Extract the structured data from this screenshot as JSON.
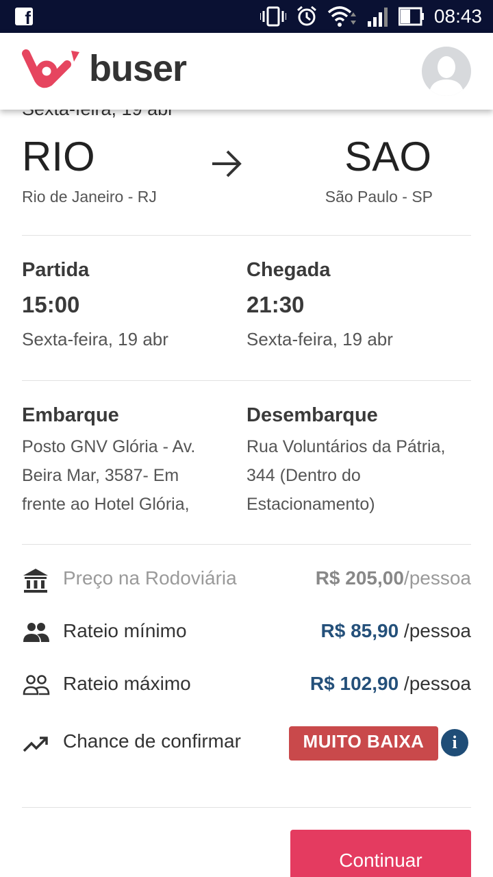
{
  "status_bar": {
    "time": "08:43",
    "icons": [
      "facebook-icon",
      "vibrate-icon",
      "alarm-icon",
      "wifi-icon",
      "signal-icon",
      "battery-icon"
    ]
  },
  "header": {
    "logo_text": "buser",
    "brand_color": "#e6455f"
  },
  "trip": {
    "date_cut": "Sexta-feira, 19 abr",
    "origin": {
      "code": "RIO",
      "city": "Rio de Janeiro - RJ"
    },
    "destination": {
      "code": "SAO",
      "city": "São Paulo - SP"
    }
  },
  "schedule": {
    "departure": {
      "label": "Partida",
      "time": "15:00",
      "date": "Sexta-feira, 19 abr"
    },
    "arrival": {
      "label": "Chegada",
      "time": "21:30",
      "date": "Sexta-feira, 19 abr"
    }
  },
  "locations": {
    "boarding": {
      "label": "Embarque",
      "lines": [
        "Posto GNV Glória - Av.",
        "Beira Mar, 3587- Em",
        "frente ao Hotel Glória,"
      ]
    },
    "dropoff": {
      "label": "Desembarque",
      "lines": [
        "Rua Voluntários da Pátria,",
        "344 (Dentro do",
        "Estacionamento)"
      ]
    }
  },
  "pricing": {
    "bus_station": {
      "label": "Preço na Rodoviária",
      "amount": "R$ 205,00",
      "unit": "/pessoa"
    },
    "min_share": {
      "label": "Rateio mínimo",
      "amount": "R$ 85,90",
      "unit": " /pessoa"
    },
    "max_share": {
      "label": "Rateio máximo",
      "amount": "R$ 102,90",
      "unit": " /pessoa"
    },
    "confirm_chance": {
      "label": "Chance de confirmar",
      "badge": "MUITO BAIXA",
      "info": "i"
    }
  },
  "actions": {
    "continue_label": "Continuar"
  }
}
